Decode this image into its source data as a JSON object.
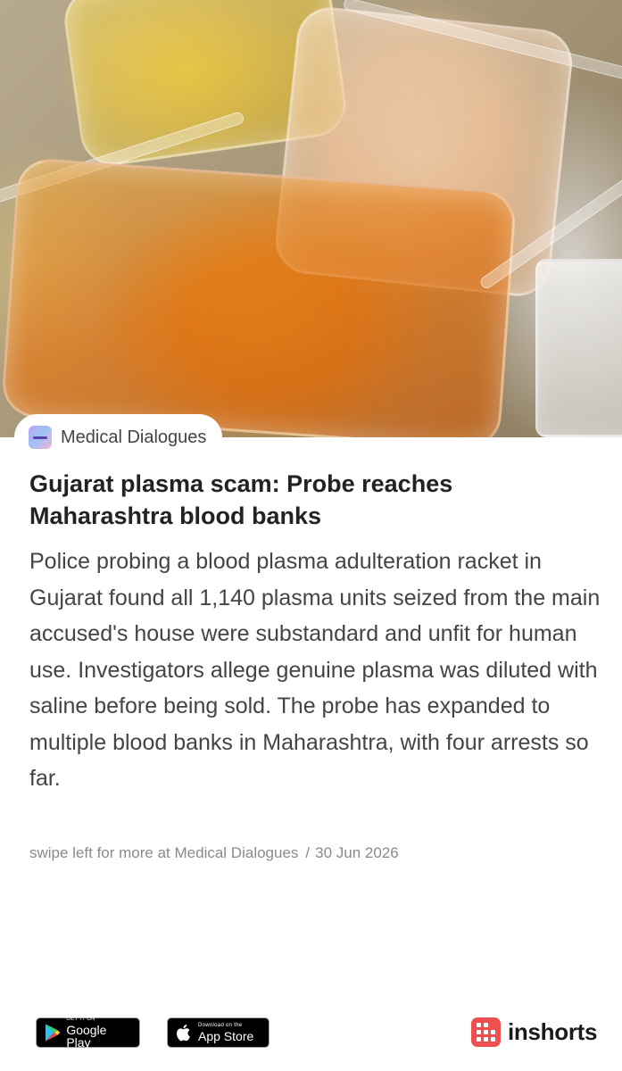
{
  "hero": {
    "icon": "plasma-bags-photo"
  },
  "source": {
    "name": "Medical Dialogues",
    "icon": "medical-dialogues-logo-icon"
  },
  "article": {
    "headline": "Gujarat plasma scam: Probe reaches Maharashtra blood banks",
    "body": "Police probing a blood plasma adulteration racket in Gujarat found all 1,140 plasma units seized from the main accused's house were substandard and unfit for human use. Investigators allege genuine plasma was diluted with saline before being sold. The probe has expanded to multiple blood banks in Maharashtra, with four arrests so far."
  },
  "meta": {
    "swipe_text": "swipe left for more at Medical Dialogues",
    "separator": "/",
    "date": "30 Jun 2026"
  },
  "footer": {
    "google_play": {
      "small": "GET IT ON",
      "big": "Google Play",
      "icon": "google-play-icon"
    },
    "app_store": {
      "small": "Download on the",
      "big": "App Store",
      "icon": "apple-icon"
    },
    "brand": {
      "name": "inshorts",
      "icon": "inshorts-logo-icon",
      "color": "#f04f4f"
    }
  }
}
